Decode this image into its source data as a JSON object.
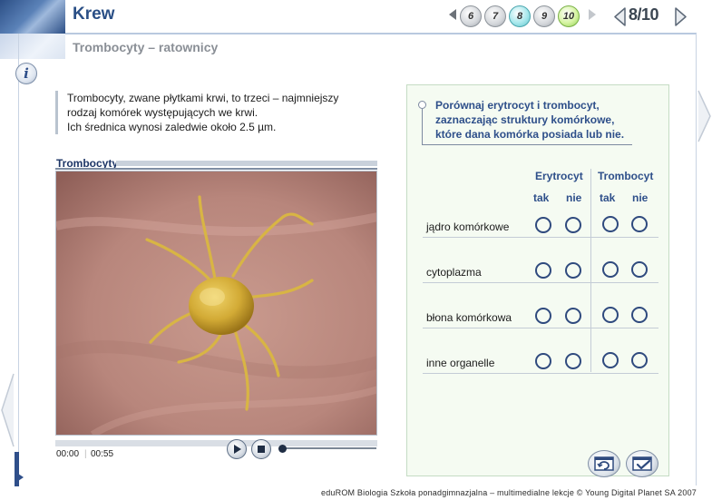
{
  "header": {
    "title": "Krew",
    "subtitle": "Trombocyty – ratownicy",
    "page_counter": "8/10",
    "pages": [
      {
        "label": "6",
        "state": "normal"
      },
      {
        "label": "7",
        "state": "normal"
      },
      {
        "label": "8",
        "state": "current"
      },
      {
        "label": "9",
        "state": "normal"
      },
      {
        "label": "10",
        "state": "latest"
      }
    ]
  },
  "intro": {
    "lines": [
      "Trombocyty, zwane płytkami krwi, to trzeci – najmniejszy",
      "rodzaj komórek występujących we krwi.",
      "Ich średnica wynosi zaledwie około 2.5 µm."
    ]
  },
  "video": {
    "title": "Trombocyty",
    "time_current": "00:00",
    "time_total": "00:55",
    "progress": 0
  },
  "exercise": {
    "task_lines": [
      "Porównaj erytrocyt i trombocyt,",
      "zaznaczając struktury komórkowe,",
      "które dana komórka posiada lub nie."
    ],
    "groups": [
      "Erytrocyt",
      "Trombocyt"
    ],
    "options": [
      "tak",
      "nie"
    ],
    "rows": [
      "jądro komórkowe",
      "cytoplazma",
      "błona komórkowa",
      "inne organelle"
    ]
  },
  "footer": "eduROM Biologia Szkoła ponadgimnazjalna – multimedialne lekcje © Young Digital Planet SA 2007",
  "icons": {
    "info": "i",
    "nav_prev": "chevron-left-icon",
    "nav_next": "chevron-right-icon",
    "reset": "reset-icon",
    "check": "check-icon"
  },
  "colors": {
    "brand": "#2a4f86",
    "panel_bg": "#f5fbf2",
    "radio": "#2f4a7e",
    "current_page": "#5ec3cc",
    "latest_page": "#8fcf52"
  }
}
